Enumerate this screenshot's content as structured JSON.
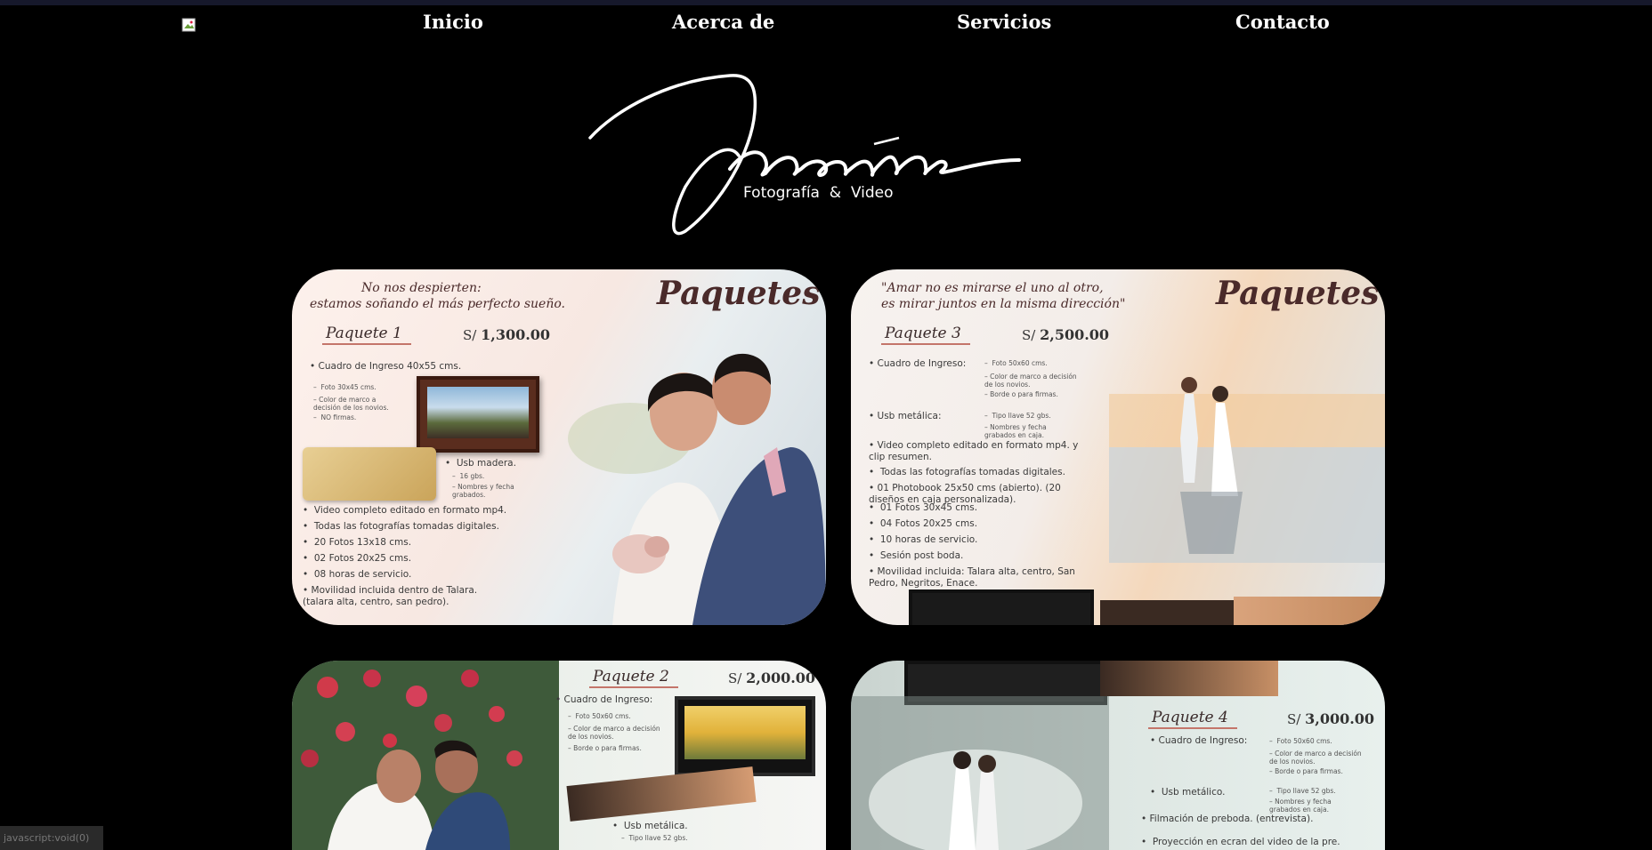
{
  "nav": {
    "links": [
      {
        "label": "Inicio"
      },
      {
        "label": "Acerca de"
      },
      {
        "label": "Servicios"
      },
      {
        "label": "Contacto"
      }
    ]
  },
  "logo": {
    "script": "Momentos",
    "tagline": "Fotografía  &  Video"
  },
  "cards": [
    {
      "heading": "Paquetes",
      "quote": [
        "No nos despierten:",
        "estamos soñando el más perfecto sueño."
      ],
      "package": "Paquete 1",
      "price_prefix": "S/ ",
      "price": "1,300.00",
      "items": [
        "• Cuadro de Ingreso 40x55 cms.",
        "–  Foto 30x45 cms.",
        "–  Color de marco a decisión de los novios.",
        "–  NO firmas.",
        "•  Usb madera.",
        "–  16 gbs.",
        "–  Nombres y fecha grabados.",
        "•  Video completo editado en formato mp4.",
        "•  Todas las fotografías tomadas digitales.",
        "•  20 Fotos 13x18 cms.",
        "•  02 Fotos 20x25 cms.",
        "•  08 horas de servicio.",
        "•  Movilidad incluida dentro de Talara. (talara alta, centro, san pedro)."
      ]
    },
    {
      "heading": "Paquetes",
      "quote": [
        "\"Amar no es mirarse el uno al otro,",
        "es mirar juntos en la misma dirección\""
      ],
      "package": "Paquete 3",
      "price_prefix": "S/ ",
      "price": "2,500.00",
      "items": [
        "• Cuadro de Ingreso:",
        "–  Foto 50x60 cms.",
        "–  Color de marco a decisión de los novios.",
        "–  Borde o para firmas.",
        "• Usb metálica:",
        "–  Tipo llave 52 gbs.",
        "–  Nombres y fecha grabados en caja.",
        "•  Video completo editado en formato mp4. y clip resumen.",
        "•  Todas las fotografías tomadas digitales.",
        "•  01 Photobook 25x50 cms (abierto). (20 diseños en caja personalizada).",
        "•  01 Fotos 30x45 cms.",
        "•  04 Fotos 20x25 cms.",
        "•  10 horas de servicio.",
        "•  Sesión post boda.",
        "•  Movilidad incluida: Talara alta, centro, San Pedro, Negritos, Enace."
      ]
    },
    {
      "package": "Paquete 2",
      "price_prefix": "S/ ",
      "price": "2,000.00",
      "items": [
        "• Cuadro de Ingreso:",
        "–  Foto 50x60 cms.",
        "–  Color de marco a decisión de los novios.",
        "–  Borde o para firmas.",
        "•  Usb metálica.",
        "–  Tipo llave 52 gbs."
      ]
    },
    {
      "package": "Paquete 4",
      "price_prefix": "S/ ",
      "price": "3,000.00",
      "items": [
        "• Cuadro de Ingreso:",
        "–  Foto 50x60 cms.",
        "–  Color de marco a decisión de los novios.",
        "–  Borde o para firmas.",
        "•  Usb metálico.",
        "–  Tipo llave 52 gbs.",
        "–  Nombres y fecha grabados en caja.",
        "•  Filmación de preboda. (entrevista).",
        "•  Proyección en ecran del video de la pre."
      ]
    }
  ],
  "status_bar": {
    "text": "javascript:void(0)"
  },
  "colors": {
    "background": "#000000",
    "accent_line": "#c4756a",
    "title": "#4a2a2a"
  }
}
